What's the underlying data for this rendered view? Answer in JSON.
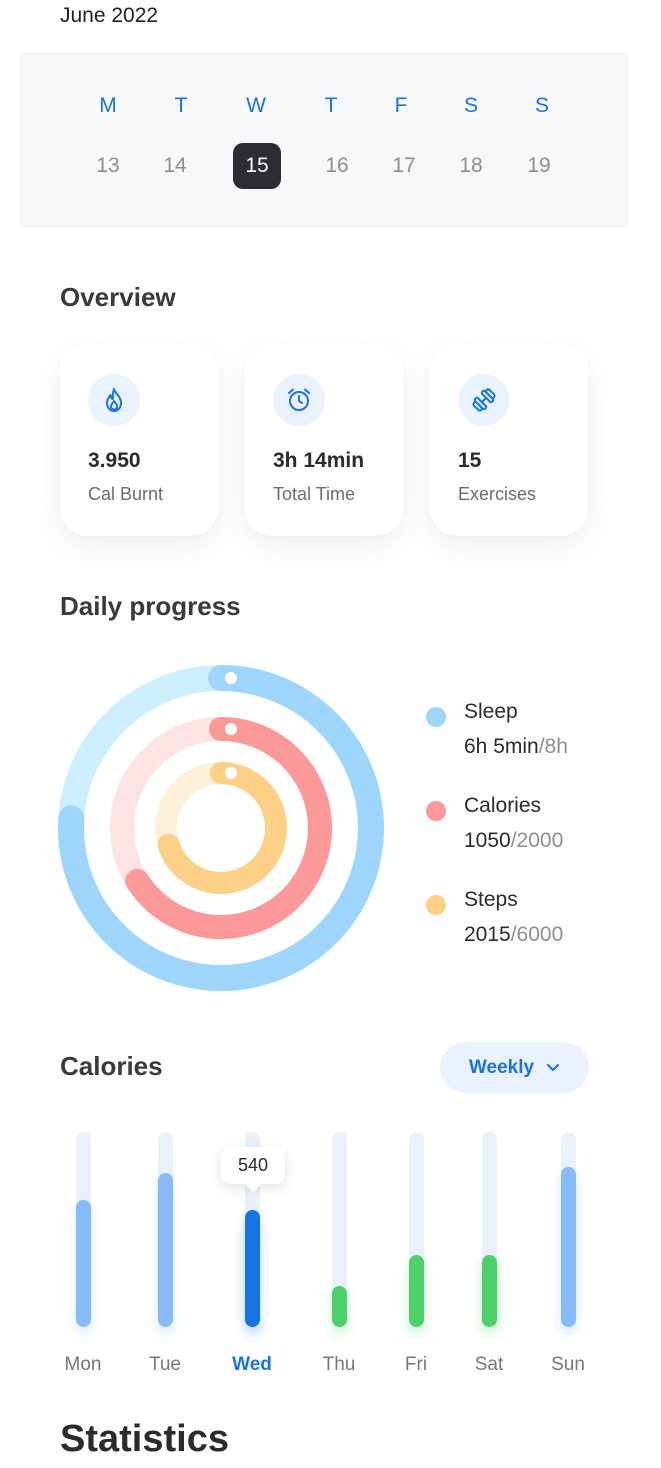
{
  "header": {
    "month": "June 2022"
  },
  "week": {
    "days": [
      {
        "letter": "M",
        "num": "13",
        "selected": false
      },
      {
        "letter": "T",
        "num": "14",
        "selected": false
      },
      {
        "letter": "W",
        "num": "15",
        "selected": true
      },
      {
        "letter": "T",
        "num": "16",
        "selected": false
      },
      {
        "letter": "F",
        "num": "17",
        "selected": false
      },
      {
        "letter": "S",
        "num": "18",
        "selected": false
      },
      {
        "letter": "S",
        "num": "19",
        "selected": false
      }
    ]
  },
  "overview": {
    "title": "Overview",
    "cards": [
      {
        "icon": "flame-icon",
        "value": "3.950",
        "label": "Cal Burnt"
      },
      {
        "icon": "alarm-clock-icon",
        "value": "3h 14min",
        "label": "Total Time"
      },
      {
        "icon": "dumbbell-icon",
        "value": "15",
        "label": "Exercises"
      }
    ]
  },
  "daily_progress": {
    "title": "Daily progress",
    "items": [
      {
        "name": "Sleep",
        "value": "6h 5min",
        "goal": "/8h",
        "fraction": 0.76,
        "color": "#9ed6fb",
        "track": "#cdeefd"
      },
      {
        "name": "Calories",
        "value": "1050",
        "goal": "/2000",
        "fraction": 0.66,
        "color": "#fb9898",
        "track": "#fde3e3"
      },
      {
        "name": "Steps",
        "value": "2015",
        "goal": "/6000",
        "fraction": 0.7,
        "color": "#fdd088",
        "track": "#fdefd8"
      }
    ]
  },
  "calories": {
    "title": "Calories",
    "range_label": "Weekly",
    "tooltip": "540",
    "colors": {
      "blue": "#86bbf7",
      "active": "#1673e4",
      "green": "#4cd06a"
    }
  },
  "chart_data": {
    "type": "bar",
    "categories": [
      "Mon",
      "Tue",
      "Wed",
      "Thu",
      "Fri",
      "Sat",
      "Sun"
    ],
    "values": [
      0.65,
      0.79,
      0.6,
      0.21,
      0.37,
      0.37,
      0.82
    ],
    "highlight": "Wed",
    "highlight_label": "540",
    "bar_colors": [
      "blue",
      "blue",
      "active",
      "green",
      "green",
      "green",
      "blue"
    ]
  },
  "statistics": {
    "title": "Statistics"
  }
}
